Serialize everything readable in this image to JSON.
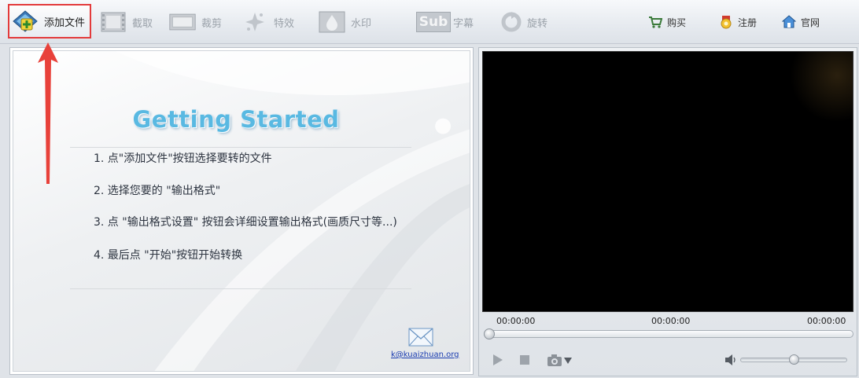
{
  "toolbar": {
    "add_file": "添加文件",
    "capture": "截取",
    "crop": "裁剪",
    "effects": "特效",
    "watermark": "水印",
    "subtitle": "字幕",
    "subtitle_icon_text": "Sub",
    "rotate": "旋转",
    "buy": "购买",
    "register": "注册",
    "website": "官网"
  },
  "guide": {
    "title": "Getting Started",
    "steps": [
      "1. 点\"添加文件\"按钮选择要转的文件",
      "2. 选择您要的 \"输出格式\"",
      "3. 点 \"输出格式设置\" 按钮会详细设置输出格式(画质尺寸等...)",
      "4. 最后点 \"开始\"按钮开始转换"
    ],
    "email": "k@kuaizhuan.org"
  },
  "player": {
    "time_current": "00:00:00",
    "time_middle": "00:00:00",
    "time_total": "00:00:00",
    "seek_progress": 0,
    "volume_level": 0.5
  },
  "colors": {
    "highlight_border": "#e33b3b",
    "title_blue": "#59b9e2",
    "link_blue": "#1a3cb0"
  }
}
